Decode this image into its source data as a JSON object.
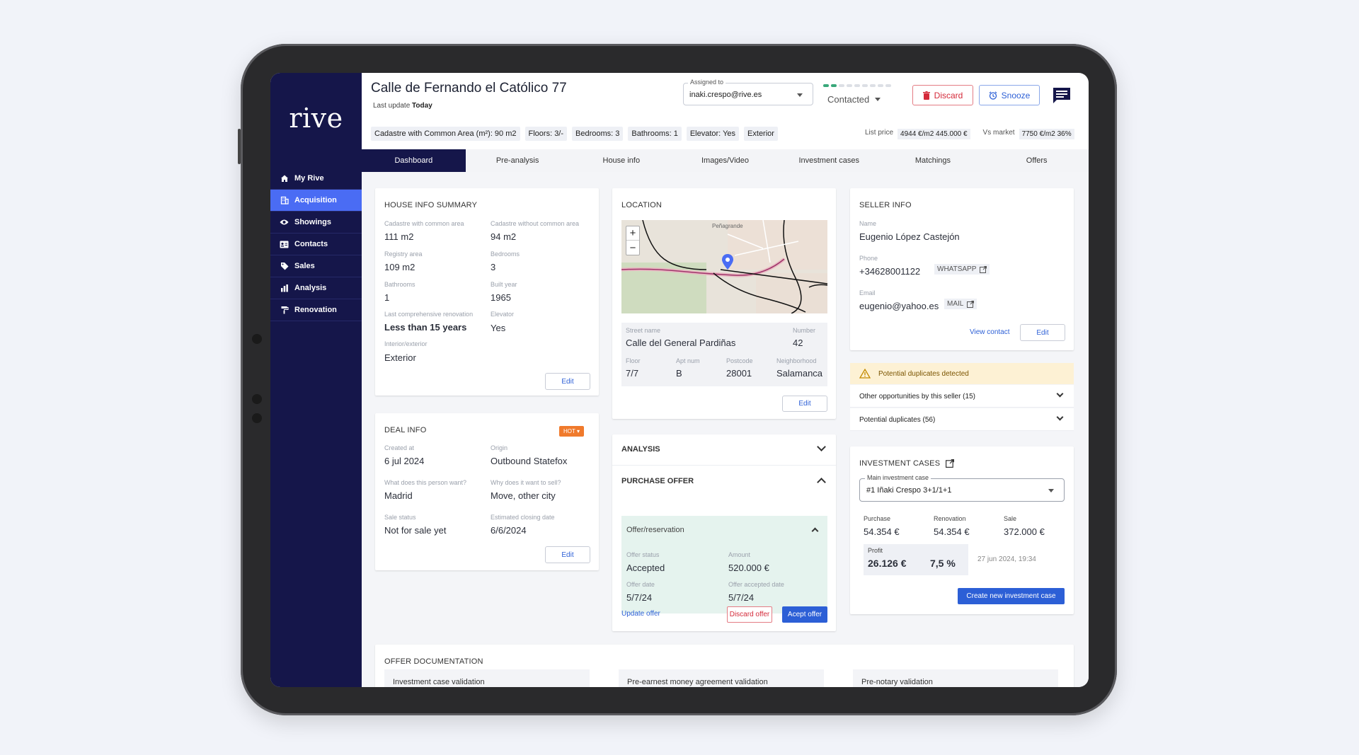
{
  "sidebar": {
    "logo": "rive",
    "items": [
      {
        "label": "My Rive",
        "icon": "home-icon"
      },
      {
        "label": "Acquisition",
        "icon": "building-icon"
      },
      {
        "label": "Showings",
        "icon": "eye-icon"
      },
      {
        "label": "Contacts",
        "icon": "contact-card-icon"
      },
      {
        "label": "Sales",
        "icon": "tag-icon"
      },
      {
        "label": "Analysis",
        "icon": "chart-icon"
      },
      {
        "label": "Renovation",
        "icon": "paint-roller-icon"
      }
    ],
    "active_index": 1
  },
  "header": {
    "title": "Calle de Fernando el Católico 77",
    "last_update_label": "Last update",
    "last_update_value": "Today",
    "assigned_label": "Assigned to",
    "assigned_value": "inaki.crespo@rive.es",
    "status_value": "Contacted",
    "progress_steps_total": 9,
    "progress_steps_done": 2,
    "discard_label": "Discard",
    "snooze_label": "Snooze",
    "chips": [
      "Cadastre with Common Area (m²): 90 m2",
      "Floors: 3/-",
      "Bedrooms: 3",
      "Bathrooms: 1",
      "Elevator: Yes",
      "Exterior"
    ],
    "list_price_label": "List price",
    "list_price_value": "4944 €/m2 445.000 €",
    "vs_market_label": "Vs market",
    "vs_market_value": "7750 €/m2 36%"
  },
  "tabs": [
    "Dashboard",
    "Pre-analysis",
    "House info",
    "Images/Video",
    "Investment cases",
    "Matchings",
    "Offers"
  ],
  "house_info": {
    "title": "HOUSE INFO SUMMARY",
    "fields": [
      {
        "label": "Cadastre with common area",
        "value": "111 m2"
      },
      {
        "label": "Cadastre without common area",
        "value": "94 m2"
      },
      {
        "label": "Registry area",
        "value": "109 m2"
      },
      {
        "label": "Bedrooms",
        "value": "3"
      },
      {
        "label": "Bathrooms",
        "value": "1"
      },
      {
        "label": "Built year",
        "value": "1965"
      },
      {
        "label": "Last comprehensive renovation",
        "value": "Less than 15 years"
      },
      {
        "label": "Elevator",
        "value": "Yes"
      },
      {
        "label": "Interior/exterior",
        "value": "Exterior"
      }
    ],
    "edit_label": "Edit"
  },
  "deal_info": {
    "title": "DEAL INFO",
    "badge": "HOT",
    "fields": [
      {
        "label": "Created at",
        "value": "6 jul 2024"
      },
      {
        "label": "Origin",
        "value": "Outbound Statefox"
      },
      {
        "label": "What does this person want?",
        "value": "Madrid"
      },
      {
        "label": "Why does it want to sell?",
        "value": "Move, other city"
      },
      {
        "label": "Sale status",
        "value": "Not for sale yet"
      },
      {
        "label": "Estimated closing date",
        "value": "6/6/2024"
      }
    ],
    "edit_label": "Edit"
  },
  "location": {
    "title": "LOCATION",
    "map_label": "Peñagrande",
    "street_label": "Street name",
    "street_value": "Calle del General Pardiñas",
    "number_label": "Number",
    "number_value": "42",
    "floor_label": "Floor",
    "floor_value": "7/7",
    "apt_label": "Apt num",
    "apt_value": "B",
    "postcode_label": "Postcode",
    "postcode_value": "28001",
    "neighborhood_label": "Neighborhood",
    "neighborhood_value": "Salamanca",
    "edit_label": "Edit"
  },
  "analysis": {
    "title": "ANALYSIS"
  },
  "purchase_offer": {
    "title": "PURCHASE OFFER",
    "sub_title": "Offer/reservation",
    "status_label": "Offer status",
    "status_value": "Accepted",
    "amount_label": "Amount",
    "amount_value": "520.000 €",
    "date_label": "Offer date",
    "date_value": "5/7/24",
    "accepted_label": "Offer accepted date",
    "accepted_value": "5/7/24",
    "update_label": "Update offer",
    "discard_label": "Discard offer",
    "accept_label": "Acept offer"
  },
  "seller": {
    "title": "SELLER INFO",
    "name_label": "Name",
    "name_value": "Eugenio López Castejón",
    "phone_label": "Phone",
    "phone_value": "+34628001122",
    "phone_tag": "WHATSAPP",
    "email_label": "Email",
    "email_value": "eugenio@yahoo.es",
    "email_tag": "MAIL",
    "view_contact_label": "View contact",
    "edit_label": "Edit"
  },
  "duplicates": {
    "warning": "Potential duplicates detected",
    "rows": [
      "Other opportunities by this seller (15)",
      "Potential duplicates (56)"
    ]
  },
  "investment": {
    "title": "INVESTMENT CASES",
    "select_label": "Main investment case",
    "select_value": "#1 Iñaki Crespo 3+1/1+1",
    "purchase_label": "Purchase",
    "purchase_value": "54.354 €",
    "renovation_label": "Renovation",
    "renovation_value": "54.354 €",
    "sale_label": "Sale",
    "sale_value": "372.000 €",
    "profit_label": "Profit",
    "profit_value": "26.126 €",
    "profit_pct": "7,5 %",
    "timestamp": "27 jun 2024, 19:34",
    "create_label": "Create new investment case"
  },
  "documentation": {
    "title": "OFFER DOCUMENTATION",
    "items": [
      "Investment case validation",
      "Pre-earnest money agreement validation",
      "Pre-notary validation"
    ]
  },
  "colors": {
    "sidebar": "#15164a",
    "accent": "#4a6cf4",
    "primary": "#2c5fd6",
    "danger": "#d42a3a",
    "hot": "#f07a2c",
    "success": "#39a87a"
  }
}
